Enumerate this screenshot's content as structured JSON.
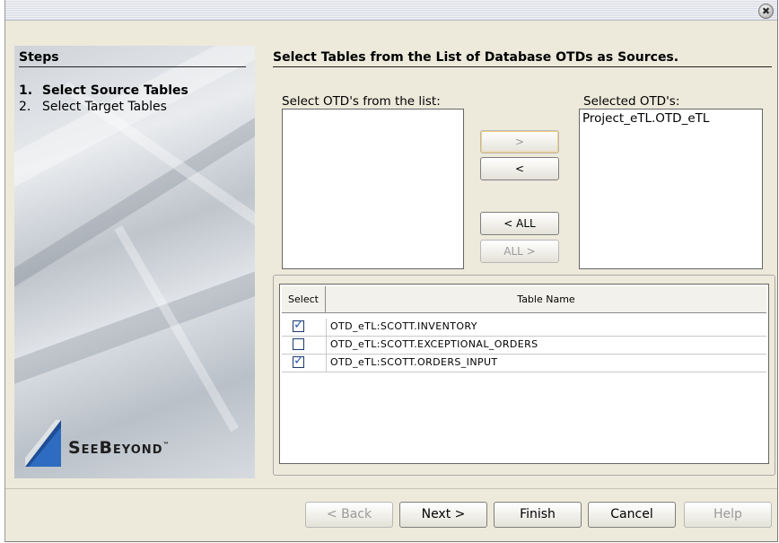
{
  "window": {
    "close_glyph": "✖"
  },
  "steps": {
    "title": "Steps",
    "items": [
      {
        "num": "1.",
        "label": "Select Source Tables",
        "active": true
      },
      {
        "num": "2.",
        "label": "Select Target Tables",
        "active": false
      }
    ],
    "logo_text": "SeeBeyond",
    "logo_tm": "™"
  },
  "main": {
    "title": "Select Tables from the List of Database OTDs as Sources.",
    "available_label": "Select OTD's from the list:",
    "available_items": [],
    "selected_label": "Selected OTD's:",
    "selected_items": [
      "Project_eTL.OTD_eTL"
    ],
    "buttons": {
      "add": ">",
      "remove": "<",
      "remove_all": "< ALL",
      "add_all": "ALL >"
    }
  },
  "table": {
    "headers": {
      "select": "Select",
      "name": "Table Name"
    },
    "rows": [
      {
        "checked": true,
        "name": "OTD_eTL:SCOTT.INVENTORY"
      },
      {
        "checked": false,
        "name": "OTD_eTL:SCOTT.EXCEPTIONAL_ORDERS"
      },
      {
        "checked": true,
        "name": "OTD_eTL:SCOTT.ORDERS_INPUT"
      }
    ]
  },
  "footer": {
    "back": "< Back",
    "next": "Next >",
    "finish": "Finish",
    "cancel": "Cancel",
    "help": "Help"
  },
  "colors": {
    "dialog_bg": "#edeadb",
    "focus_border": "#d9a434",
    "check": "#2a5db0",
    "logo_blue": "#1f4e96"
  }
}
